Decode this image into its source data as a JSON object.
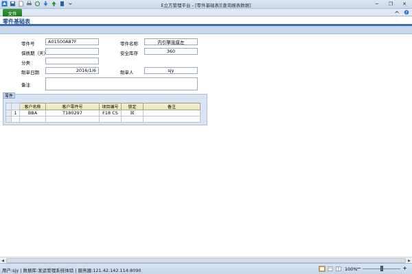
{
  "window": {
    "title": "E立方管理平台 - [零件基础表][查询报表数据]",
    "minimize": "─",
    "restore": "❐",
    "close": "✕"
  },
  "ribbon": {
    "file_tab": "文件"
  },
  "document": {
    "title": "零件基础表"
  },
  "form": {
    "part_no_label": "零件号",
    "part_no_value": "A01500A87F",
    "part_name_label": "零件名称",
    "part_name_value": "内引擎底座左",
    "warranty_label": "保质期（天）",
    "warranty_value": "",
    "safety_stock_label": "安全库存",
    "safety_stock_value": "360",
    "category_label": "分类",
    "category_value": "",
    "date_label": "制单日期",
    "date_value": "2016/1/6",
    "maker_label": "制单人",
    "maker_value": "sjy",
    "remark_label": "备注",
    "remark_value": ""
  },
  "parts_panel": {
    "caption": "零件",
    "columns": [
      "客户名称",
      "客户零件号",
      "项目编号",
      "锁定",
      "备注"
    ],
    "rows": [
      {
        "row_no": "1",
        "customer": "BBA",
        "customer_part_no": "T180297",
        "project_no": "F18 CS",
        "locked": "☒",
        "remark": ""
      }
    ]
  },
  "statusbar": {
    "text": "用户:sjy | 数据库:发运管理系统体验 | 服务器:121.42.142.114:8090",
    "zoom": "100%",
    "zoom_level_fraction": 0.5
  },
  "colors": {
    "accent": "#3d6db0",
    "file_tab": "#2a8a2a",
    "header_band": "#c7d8ee"
  }
}
